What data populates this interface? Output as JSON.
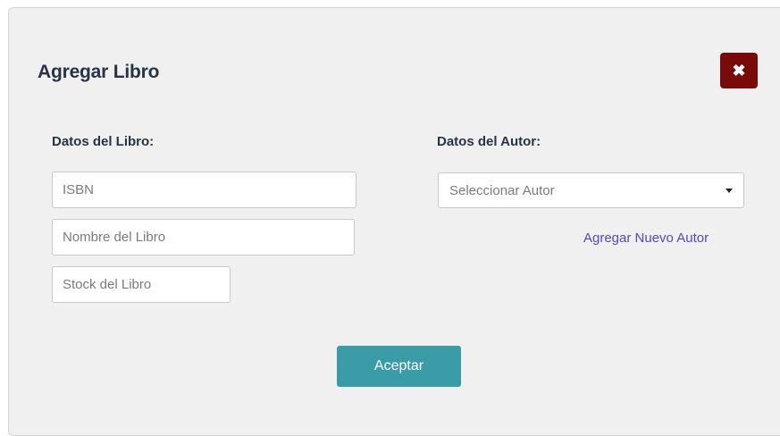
{
  "modal": {
    "title": "Agregar Libro",
    "close_symbol": "✖"
  },
  "book_section": {
    "label": "Datos del Libro:",
    "isbn_placeholder": "ISBN",
    "isbn_value": "",
    "name_placeholder": "Nombre del Libro",
    "name_value": "",
    "stock_placeholder": "Stock del Libro",
    "stock_value": ""
  },
  "author_section": {
    "label": "Datos del Autor:",
    "select_selected": "Seleccionar Autor",
    "new_author_link": "Agregar Nuevo Autor"
  },
  "actions": {
    "accept_label": "Aceptar"
  },
  "colors": {
    "close_button": "#7a0a0a",
    "accept_button": "#3a9ca6",
    "link": "#5746c9",
    "heading": "#263445",
    "modal_background": "#f0f0f0"
  },
  "icons": {
    "close": "close-icon",
    "dropdown": "chevron-down-icon"
  }
}
